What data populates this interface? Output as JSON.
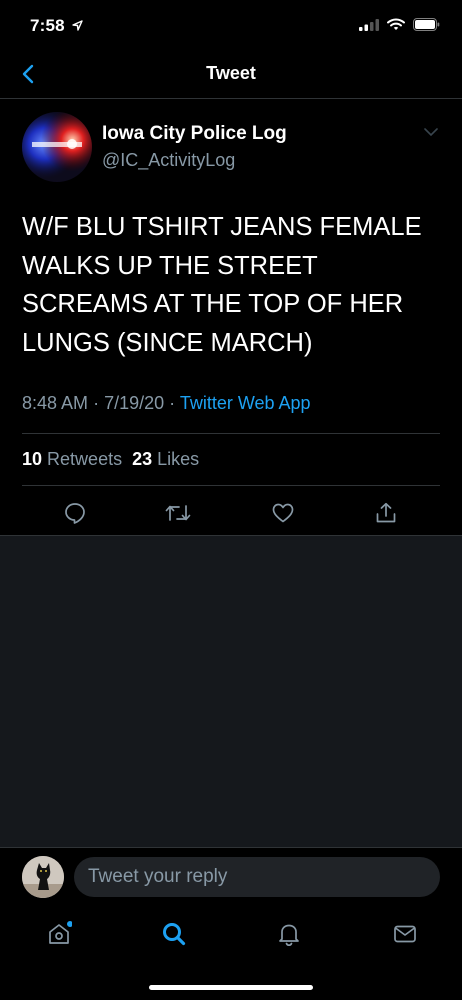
{
  "status_bar": {
    "time": "7:58"
  },
  "header": {
    "title": "Tweet"
  },
  "tweet": {
    "display_name": "Iowa City Police Log",
    "handle": "@IC_ActivityLog",
    "text": "W/F BLU TSHIRT JEANS FEMALE WALKS UP THE STREET SCREAMS AT THE TOP OF HER LUNGS (SINCE MARCH)",
    "time": "8:48 AM",
    "date": "7/19/20",
    "separator": "·",
    "source": "Twitter Web App",
    "retweet_count": "10",
    "retweet_label": "Retweets",
    "like_count": "23",
    "like_label": "Likes"
  },
  "reply": {
    "placeholder": "Tweet your reply"
  },
  "colors": {
    "accent": "#1da1f2",
    "muted": "#8899a6",
    "divider": "#2f3336",
    "background": "#000000",
    "empty": "#15181c"
  }
}
